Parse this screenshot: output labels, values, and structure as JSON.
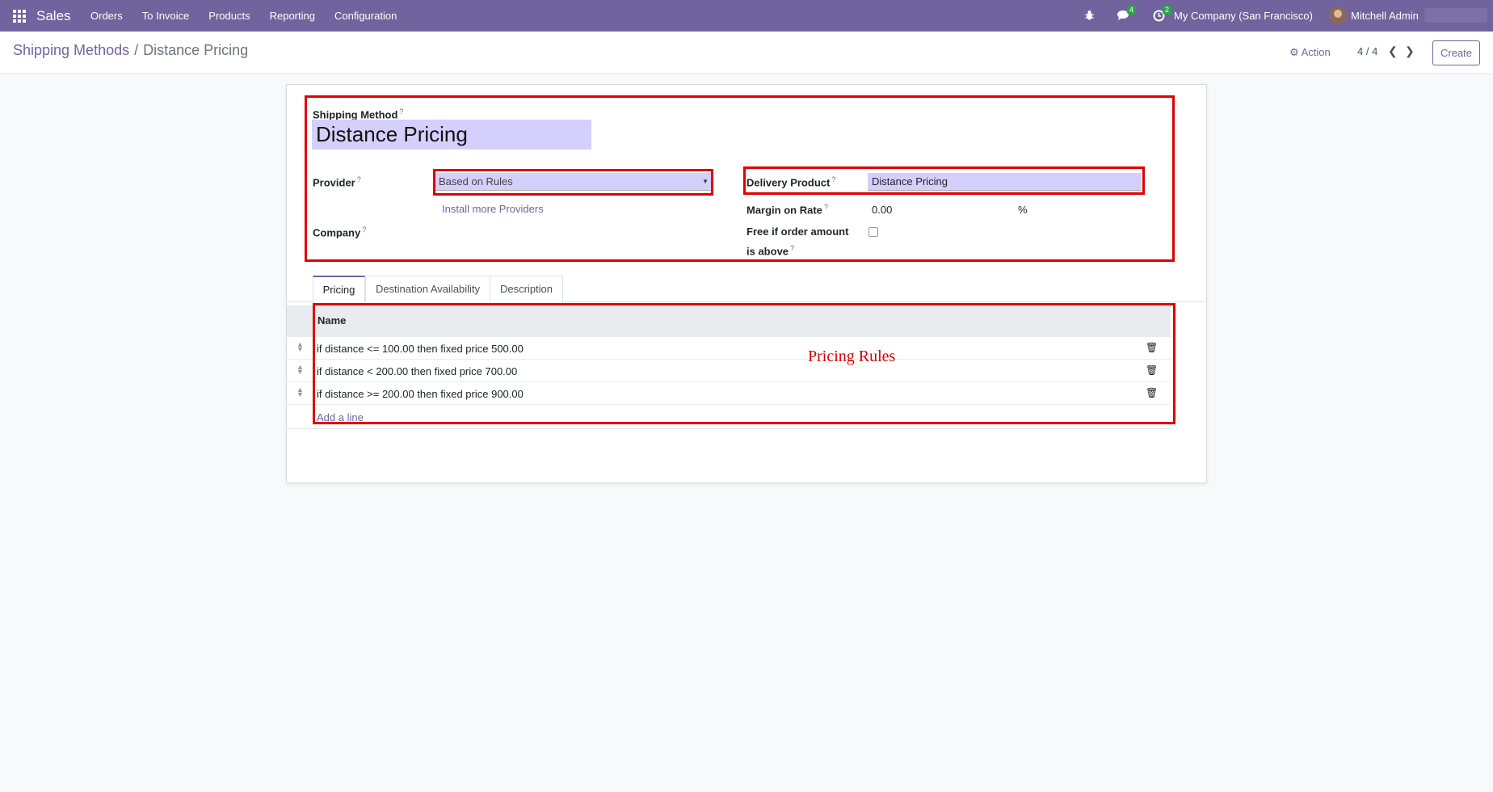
{
  "navbar": {
    "app_name": "Sales",
    "menu": [
      "Orders",
      "To Invoice",
      "Products",
      "Reporting",
      "Configuration"
    ],
    "messages_count": "4",
    "activities_count": "2",
    "company": "My Company (San Francisco)",
    "user": "Mitchell Admin",
    "icons": [
      "apps-grid-icon",
      "bug-icon",
      "chat-icon",
      "clock-icon",
      "avatar"
    ]
  },
  "control": {
    "breadcrumb_parent": "Shipping Methods",
    "breadcrumb_sep": "/",
    "breadcrumb_current": "Distance Pricing",
    "action_label": "Action",
    "pager": "4 / 4",
    "create_label": "Create"
  },
  "form": {
    "shipping_method_label": "Shipping Method",
    "shipping_method_value": "Distance Pricing",
    "provider_label": "Provider",
    "provider_value": "Based on Rules",
    "install_link": "Install more Providers",
    "company_label": "Company",
    "delivery_product_label": "Delivery Product",
    "delivery_product_value": "Distance Pricing",
    "margin_label": "Margin on Rate",
    "margin_value": "0.00",
    "margin_unit": "%",
    "free_label_1": "Free if order amount",
    "free_label_2": "is above",
    "free_checked": false,
    "help_mark": "?"
  },
  "tabs": [
    {
      "label": "Pricing",
      "active": true
    },
    {
      "label": "Destination Availability",
      "active": false
    },
    {
      "label": "Description",
      "active": false
    }
  ],
  "table": {
    "header": "Name",
    "rows": [
      "if distance <= 100.00 then fixed price 500.00",
      "if distance < 200.00 then fixed price 700.00",
      "if distance >= 200.00 then fixed price 900.00"
    ],
    "add_line": "Add a line"
  },
  "annotation": {
    "label": "Pricing Rules",
    "color": "#e00000"
  },
  "colors": {
    "brand": "#71639e",
    "input_bg": "#d4d0fb",
    "badge": "#28a745"
  }
}
